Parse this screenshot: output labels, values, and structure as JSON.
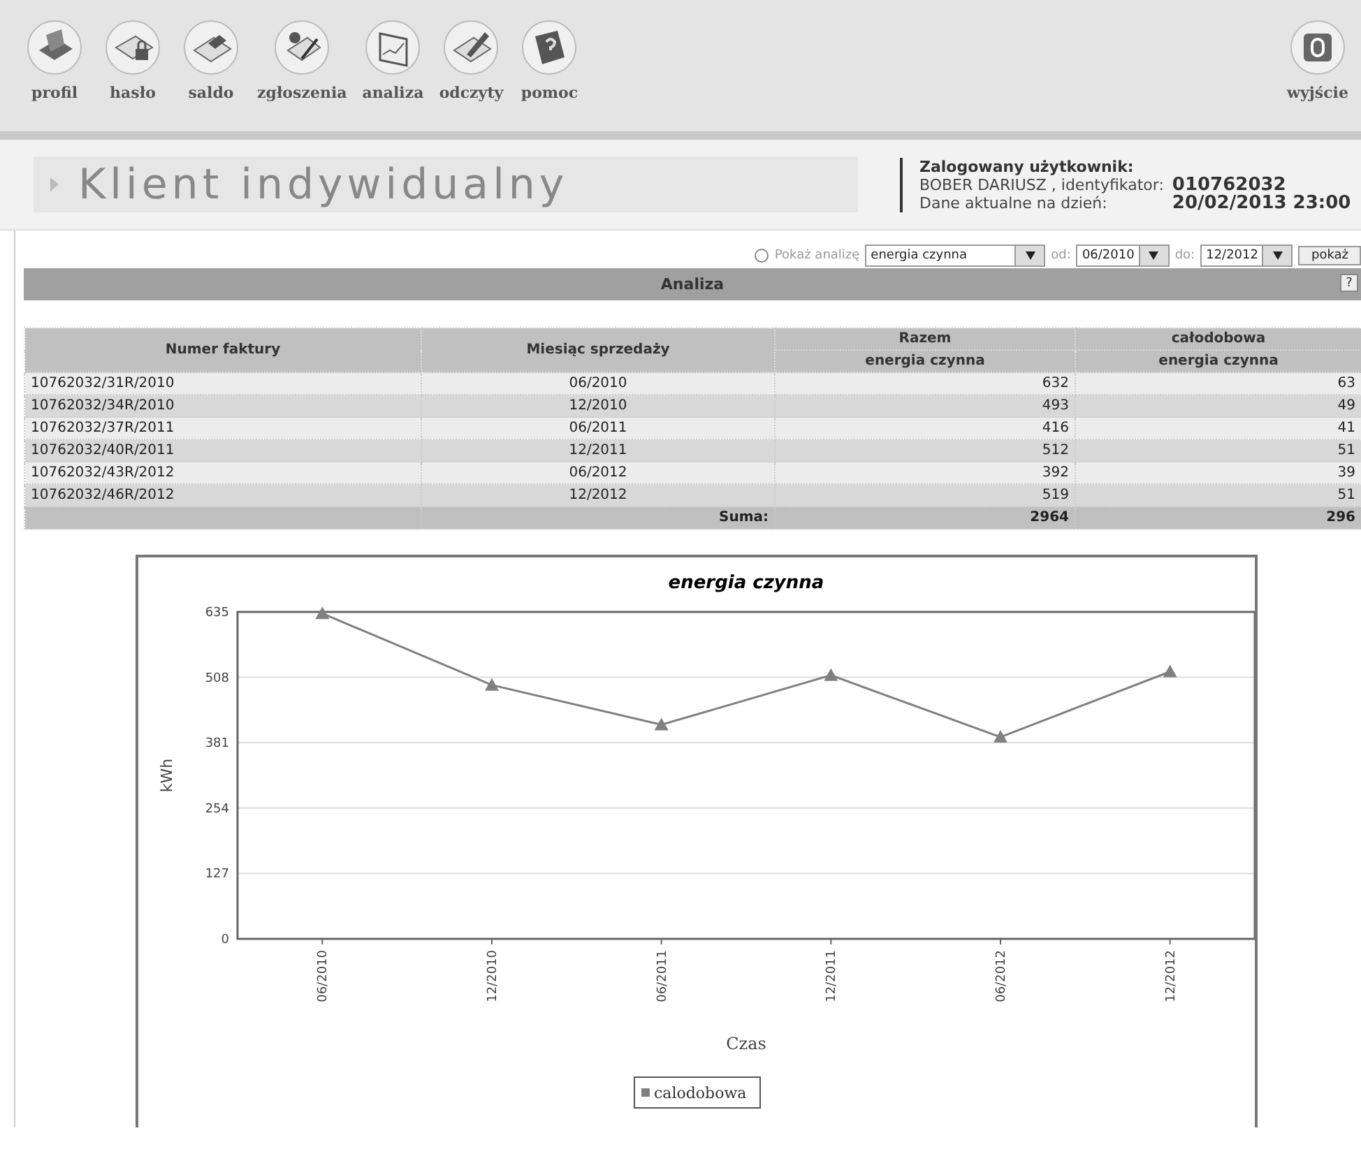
{
  "nav": {
    "items": [
      {
        "label": "profil"
      },
      {
        "label": "hasło"
      },
      {
        "label": "saldo"
      },
      {
        "label": "zgłoszenia"
      },
      {
        "label": "analiza"
      },
      {
        "label": "odczyty"
      },
      {
        "label": "pomoc"
      }
    ],
    "exit": {
      "label": "wyjście"
    }
  },
  "page_title": "Klient indywidualny",
  "user_info": {
    "heading": "Zalogowany użytkownik:",
    "name": "BOBER DARIUSZ , identyfikator:",
    "id": "010762032",
    "date_label": "Dane aktualne na dzień:",
    "date": "20/02/2013 23:00"
  },
  "filter": {
    "radio": {
      "label": "Pokaż analizę",
      "selected": false
    },
    "analysis": "energia czynna",
    "from_label": "od:",
    "from": "06/2010",
    "to_label": "do:",
    "to": "12/2012",
    "button": "pokaż"
  },
  "section": {
    "title": "Analiza",
    "help": "?"
  },
  "table": {
    "columns": [
      {
        "label": "Numer faktury"
      },
      {
        "label": "Miesiąc sprzedaży"
      },
      {
        "label": "Razem",
        "sublabel": "energia czynna"
      },
      {
        "label": "całodobowa",
        "sublabel": "energia czynna"
      }
    ],
    "rows": [
      [
        "10762032/31R/2010",
        "06/2010",
        "632",
        "63"
      ],
      [
        "10762032/34R/2010",
        "12/2010",
        "493",
        "49"
      ],
      [
        "10762032/37R/2011",
        "06/2011",
        "416",
        "41"
      ],
      [
        "10762032/40R/2011",
        "12/2011",
        "512",
        "51"
      ],
      [
        "10762032/43R/2012",
        "06/2012",
        "392",
        "39"
      ],
      [
        "10762032/46R/2012",
        "12/2012",
        "519",
        "51"
      ]
    ],
    "total_row": {
      "label": "Suma:",
      "values": [
        "2964",
        "296"
      ]
    }
  },
  "chart": {
    "chart_data": {
      "type": "line",
      "title": "energia czynna",
      "xlabel": "Czas",
      "ylabel": "kWh",
      "categories": [
        "06/2010",
        "12/2010",
        "06/2011",
        "12/2011",
        "06/2012",
        "12/2012"
      ],
      "series": [
        {
          "name": "calodobowa",
          "color": "#808080",
          "values": [
            632,
            493,
            416,
            512,
            392,
            519
          ]
        }
      ],
      "grid": true,
      "marker": "triangle",
      "ylim": [
        0,
        635
      ],
      "yticks": [
        0,
        127,
        254,
        381,
        508,
        635
      ]
    }
  }
}
